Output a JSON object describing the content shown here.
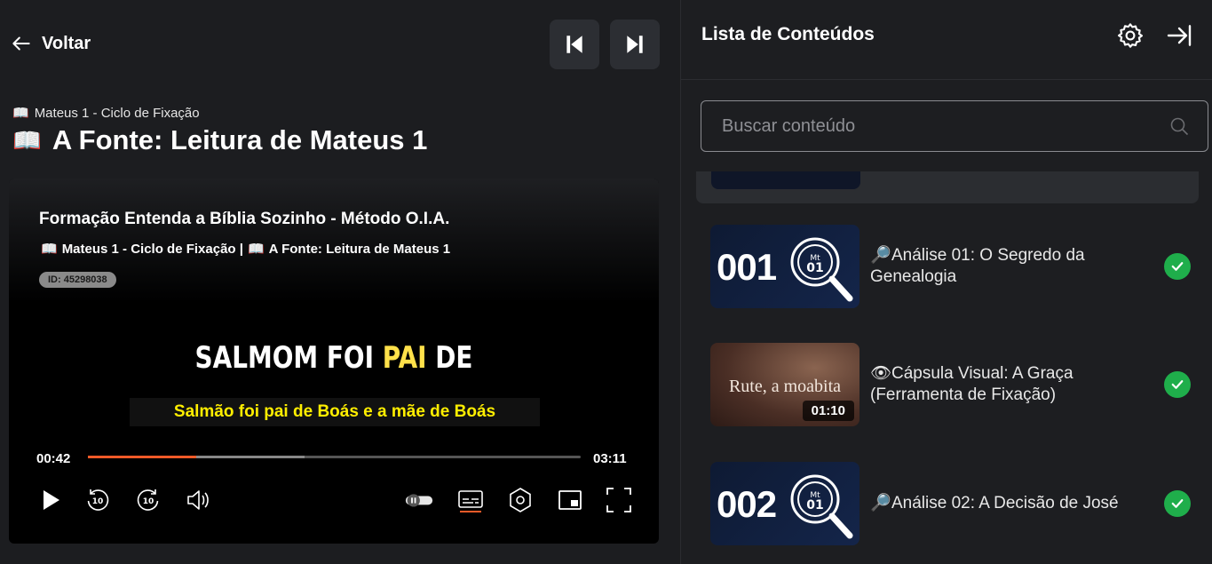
{
  "header": {
    "back_label": "Voltar"
  },
  "lesson": {
    "breadcrumb_icon": "📖",
    "breadcrumb": "Mateus 1 - Ciclo de Fixação",
    "title_icon": "📖",
    "title": "A Fonte: Leitura de Mateus 1"
  },
  "player": {
    "video_title": "Formação Entenda a Bíblia Sozinho - Método O.I.A.",
    "video_subtitle_icon1": "📖",
    "video_subtitle_part1": "Mateus 1 - Ciclo de Fixação |",
    "video_subtitle_icon2": "📖",
    "video_subtitle_part2": "A Fonte: Leitura de Mateus 1",
    "video_id": "ID: 45298038",
    "caption_main_prefix": "SALMOM FOI ",
    "caption_main_highlight": "PAI",
    "caption_main_suffix": " DE",
    "caption_sub": "Salmão foi pai de Boás e a mãe de Boás",
    "current_time": "00:42",
    "duration": "03:11",
    "progress_fraction": 0.22,
    "buffered_fraction": 0.44,
    "accent_color": "#f05a28"
  },
  "sidebar": {
    "title": "Lista de Conteúdos",
    "search_placeholder": "Buscar conteúdo",
    "items": [
      {
        "thumb_type": "number",
        "thumb_number": "001",
        "icon": "🔎",
        "label": "Análise 01: O Segredo da Genealogia",
        "completed": true
      },
      {
        "thumb_type": "image",
        "thumb_text": "Rute, a moabita",
        "duration": "01:10",
        "icon": "👁",
        "label": "Cápsula Visual: A Graça (Ferramenta de Fixação)",
        "completed": true
      },
      {
        "thumb_type": "number",
        "thumb_number": "002",
        "icon": "🔎",
        "label": "Análise 02: A Decisão de José",
        "completed": true
      }
    ],
    "check_color": "#1fae4b"
  }
}
